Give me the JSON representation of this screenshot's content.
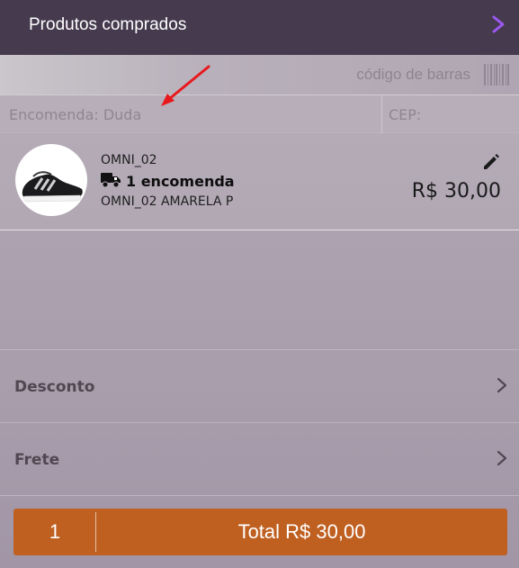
{
  "header": {
    "title": "Produtos comprados",
    "chevron_icon": "chevron-right-icon",
    "chevron_color": "#9b59f0"
  },
  "barcode": {
    "label": "código de barras",
    "icon": "barcode-icon"
  },
  "fields": {
    "order_placeholder": "Encomenda: Duda",
    "cep_placeholder": "CEP:"
  },
  "product": {
    "sku": "OMNI_02",
    "orders": "1 encomenda",
    "description": "OMNI_02 AMARELA P",
    "price": "R$ 30,00",
    "image": "sneaker-thumbnail",
    "edit_icon": "pencil-icon",
    "truck_icon": "truck-icon"
  },
  "summary": {
    "discount_label": "Desconto",
    "shipping_label": "Frete"
  },
  "checkout": {
    "quantity": "1",
    "total_label": "Total R$ 30,00",
    "color": "#bf5f20"
  },
  "annotation": {
    "icon": "red-arrow-annotation",
    "color": "#e8191c"
  }
}
